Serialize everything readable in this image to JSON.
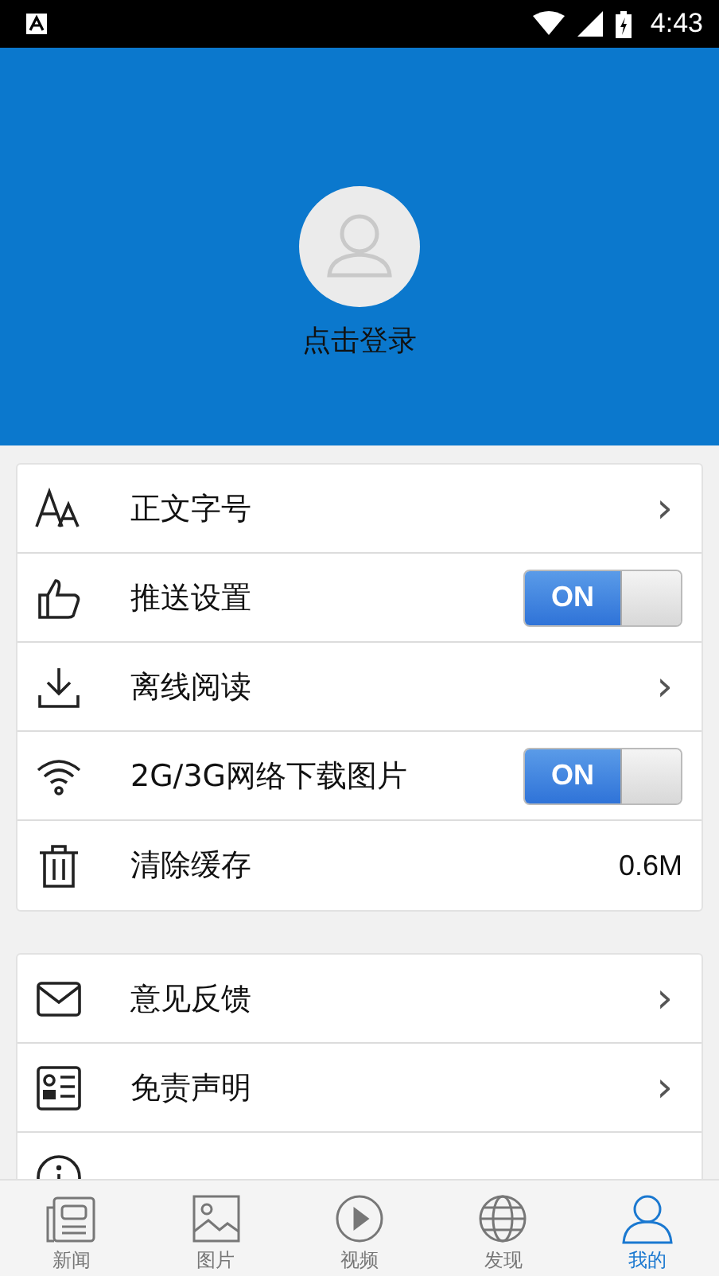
{
  "status_bar": {
    "time": "4:43"
  },
  "profile": {
    "login_label": "点击登录"
  },
  "settings_groups": [
    {
      "items": [
        {
          "kind": "link",
          "label": "正文字号",
          "chevron": "›"
        },
        {
          "kind": "toggle",
          "label": "推送设置",
          "on": true,
          "toggle_label": "ON"
        },
        {
          "kind": "link",
          "label": "离线阅读",
          "chevron": "›"
        },
        {
          "kind": "toggle",
          "label": "2G/3G网络下载图片",
          "on": true,
          "toggle_label": "ON"
        },
        {
          "kind": "value",
          "label": "清除缓存",
          "value": "0.6M"
        }
      ]
    },
    {
      "items": [
        {
          "kind": "link",
          "label": "意见反馈",
          "chevron": "›"
        },
        {
          "kind": "link",
          "label": "免责声明",
          "chevron": "›"
        },
        {
          "kind": "cut_off"
        }
      ]
    }
  ],
  "tab_bar": [
    {
      "label": "新闻",
      "selected": false
    },
    {
      "label": "图片",
      "selected": false
    },
    {
      "label": "视频",
      "selected": false
    },
    {
      "label": "发现",
      "selected": false
    },
    {
      "label": "我的",
      "selected": true
    }
  ]
}
